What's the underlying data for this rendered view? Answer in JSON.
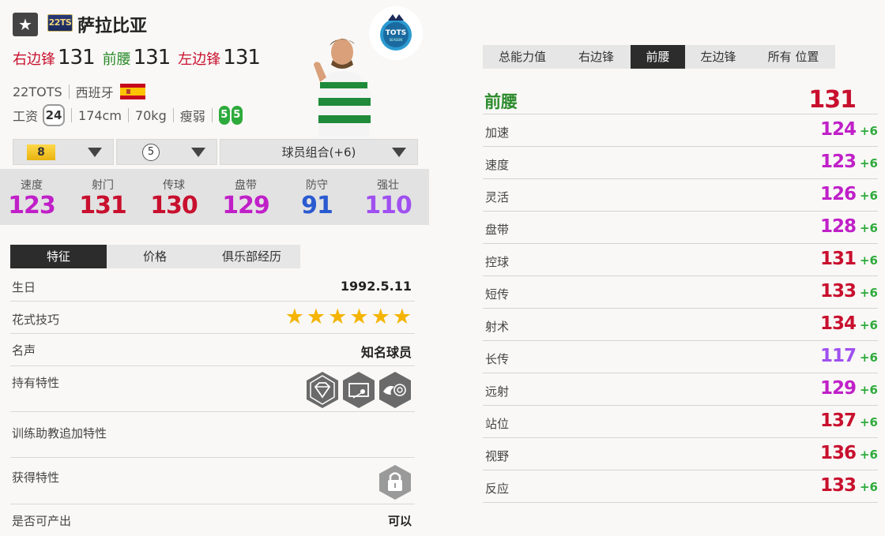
{
  "header": {
    "season_label": "22TS",
    "name": "萨拉比亚",
    "positions": [
      {
        "name": "右边锋",
        "value": "131",
        "color": "#c8102e"
      },
      {
        "name": "前腰",
        "value": "131",
        "color": "#2a8a2a"
      },
      {
        "name": "左边锋",
        "value": "131",
        "color": "#c8102e"
      }
    ],
    "season": "22TOTS",
    "nationality": "西班牙",
    "wage_label": "工资",
    "wage": "24",
    "height": "174cm",
    "weight": "70kg",
    "body_type": "瘦弱",
    "weak_foot": "5",
    "skill_foot": "5"
  },
  "selectors": {
    "grade": "8",
    "level": "5",
    "chemistry": "球员组合(+6)"
  },
  "summary_stats": [
    {
      "label": "速度",
      "value": "123",
      "color": "#c020c8"
    },
    {
      "label": "射门",
      "value": "131",
      "color": "#c8102e"
    },
    {
      "label": "传球",
      "value": "130",
      "color": "#c8102e"
    },
    {
      "label": "盘带",
      "value": "129",
      "color": "#c020c8"
    },
    {
      "label": "防守",
      "value": "91",
      "color": "#2a5ad0"
    },
    {
      "label": "强壮",
      "value": "110",
      "color": "#a050f0"
    }
  ],
  "left_tabs": [
    {
      "label": "特征",
      "active": true
    },
    {
      "label": "价格",
      "active": false
    },
    {
      "label": "俱乐部经历",
      "active": false
    }
  ],
  "traits_section": {
    "birthday_label": "生日",
    "birthday": "1992.5.11",
    "skill_moves_label": "花式技巧",
    "skill_stars": 6,
    "reputation_label": "名声",
    "reputation": "知名球员",
    "traits_label": "持有特性",
    "trait_icons": [
      "diamond-trait-icon",
      "goalkeeper-trait-icon",
      "flair-trait-icon"
    ],
    "coach_traits_label": "训练助教追加特性",
    "acquire_traits_label": "获得特性",
    "producible_label": "是否可产出",
    "producible": "可以"
  },
  "right_tabs": [
    {
      "label": "总能力值",
      "active": false
    },
    {
      "label": "右边锋",
      "active": false
    },
    {
      "label": "前腰",
      "active": true
    },
    {
      "label": "左边锋",
      "active": false
    },
    {
      "label": "所有 位置",
      "active": false
    }
  ],
  "detail": {
    "position": "前腰",
    "overall": "131",
    "attributes": [
      {
        "name": "加速",
        "value": "124",
        "bonus": "+6",
        "color": "#c020c8"
      },
      {
        "name": "速度",
        "value": "123",
        "bonus": "+6",
        "color": "#c020c8"
      },
      {
        "name": "灵活",
        "value": "126",
        "bonus": "+6",
        "color": "#c020c8"
      },
      {
        "name": "盘带",
        "value": "128",
        "bonus": "+6",
        "color": "#c020c8"
      },
      {
        "name": "控球",
        "value": "131",
        "bonus": "+6",
        "color": "#c8102e"
      },
      {
        "name": "短传",
        "value": "133",
        "bonus": "+6",
        "color": "#c8102e"
      },
      {
        "name": "射术",
        "value": "134",
        "bonus": "+6",
        "color": "#c8102e"
      },
      {
        "name": "长传",
        "value": "117",
        "bonus": "+6",
        "color": "#a050f0"
      },
      {
        "name": "远射",
        "value": "129",
        "bonus": "+6",
        "color": "#c020c8"
      },
      {
        "name": "站位",
        "value": "137",
        "bonus": "+6",
        "color": "#c8102e"
      },
      {
        "name": "视野",
        "value": "136",
        "bonus": "+6",
        "color": "#c8102e"
      },
      {
        "name": "反应",
        "value": "133",
        "bonus": "+6",
        "color": "#c8102e"
      }
    ]
  }
}
